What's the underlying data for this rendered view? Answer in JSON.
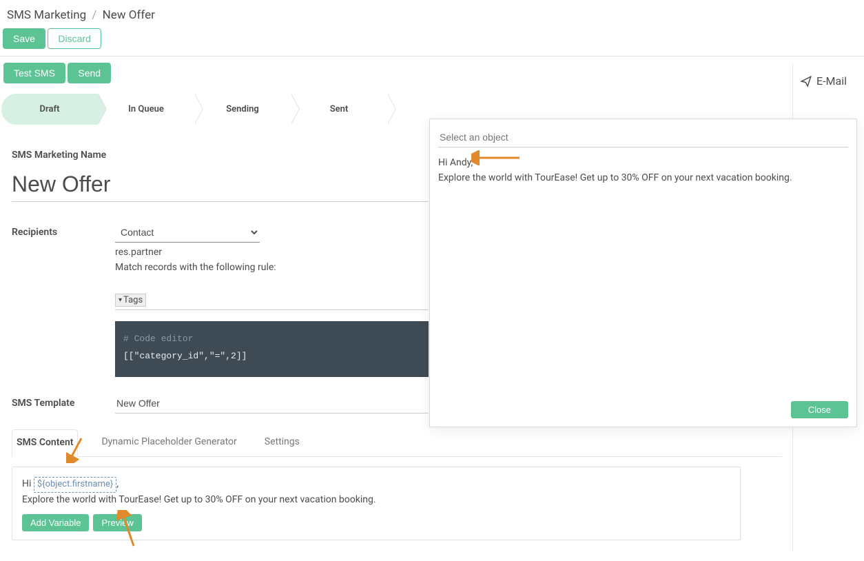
{
  "breadcrumb": {
    "root": "SMS Marketing",
    "current": "New Offer"
  },
  "buttons": {
    "save": "Save",
    "discard": "Discard",
    "test_sms": "Test SMS",
    "send": "Send",
    "add_variable": "Add Variable",
    "preview": "Preview",
    "close": "Close"
  },
  "status_steps": [
    "Draft",
    "In Queue",
    "Sending",
    "Sent"
  ],
  "right_panel": {
    "email": "E-Mail"
  },
  "form": {
    "name_label": "SMS Marketing Name",
    "name_value": "New Offer",
    "recipients_label": "Recipients",
    "recipients_select": "Contact",
    "recipients_model": "res.partner",
    "recipients_rule_hint": "Match records with the following rule:",
    "tags_label": "Tags",
    "code_comment": "# Code editor",
    "code_line": "[[\"category_id\",\"=\",2]]",
    "template_label": "SMS Template",
    "template_value": "New Offer"
  },
  "tabs": [
    "SMS Content",
    "Dynamic Placeholder Generator",
    "Settings"
  ],
  "sms": {
    "greeting_prefix": "Hi ",
    "variable": "${object.firstname}",
    "greeting_suffix": ",",
    "body": "Explore the world with TourEase! Get up to 30% OFF on your next vacation booking."
  },
  "popup": {
    "object_placeholder": "Select an object",
    "line1": "Hi Andy,",
    "line2": "Explore the world with TourEase! Get up to 30% OFF on your next vacation booking."
  },
  "colors": {
    "accent": "#5cc395",
    "arrow": "#e08a2c"
  }
}
